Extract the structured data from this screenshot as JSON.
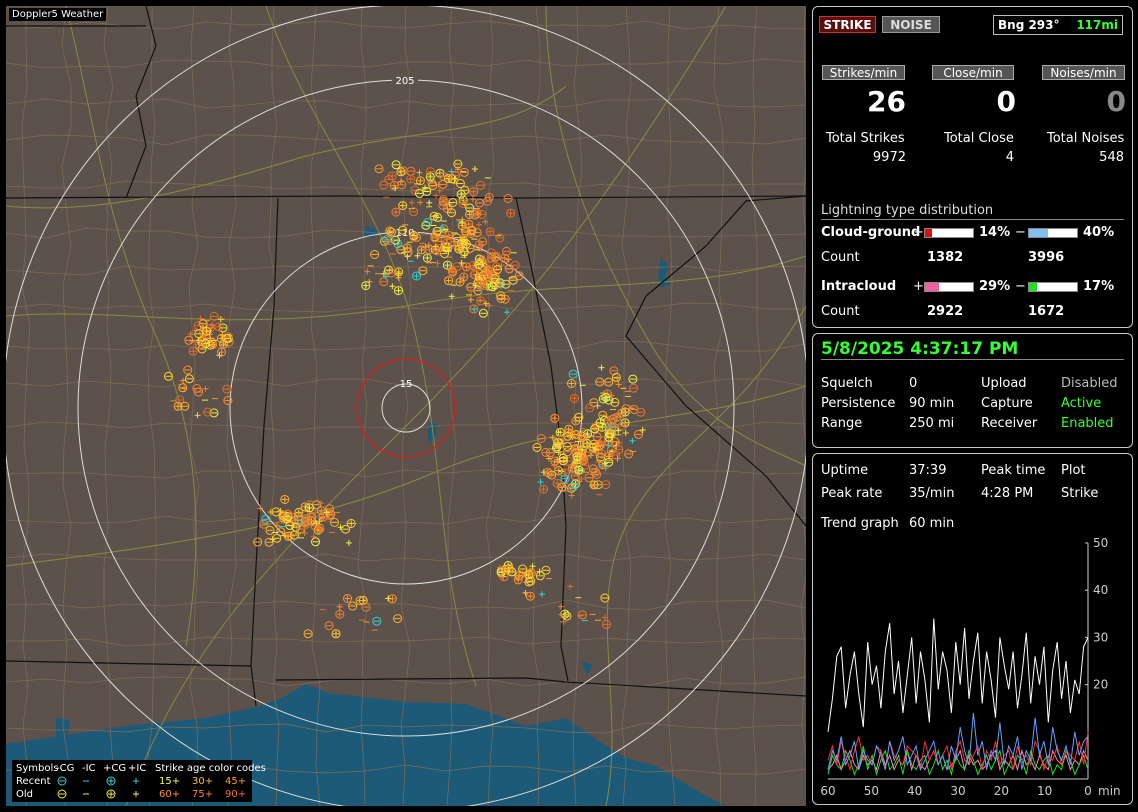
{
  "app": {
    "title": "Doppler5 Weather"
  },
  "map": {
    "ring_labels": [
      "205",
      "110",
      "15"
    ],
    "colors": {
      "land": "#5d514b",
      "water": "#1c5a78",
      "ring": "#dddddd",
      "inner_ring": "#d02020",
      "state_line": "#111111",
      "county_line": "#7d6e57",
      "road": "#8a8a3e"
    }
  },
  "legend": {
    "symbols_label": "Symbols",
    "types": [
      "-CG",
      "-IC",
      "+CG",
      "+IC"
    ],
    "age_label": "Strike age color codes",
    "recent_label": "Recent",
    "old_label": "Old",
    "recent_ages": [
      "15+",
      "30+",
      "45+"
    ],
    "old_ages": [
      "60+",
      "75+",
      "90+"
    ]
  },
  "status": {
    "strike_btn": "STRIKE",
    "noise_btn": "NOISE",
    "bearing": "Bng 293°",
    "distance": "117mi",
    "strikes_per_min_label": "Strikes/min",
    "close_per_min_label": "Close/min",
    "noises_per_min_label": "Noises/min",
    "strikes_per_min": "26",
    "close_per_min": "0",
    "noises_per_min": "0",
    "total_strikes_label": "Total Strikes",
    "total_close_label": "Total Close",
    "total_noises_label": "Total Noises",
    "total_strikes": "9972",
    "total_close": "4",
    "total_noises": "548",
    "dist_label": "Lightning type distribution",
    "cg_label": "Cloud-ground",
    "ic_label": "Intracloud",
    "count_label": "Count",
    "plus": "+",
    "minus": "−",
    "cg_pos_pct": "14%",
    "cg_neg_pct": "40%",
    "ic_pos_pct": "29%",
    "ic_neg_pct": "17%",
    "cg_pos_frac": 0.14,
    "cg_neg_frac": 0.4,
    "ic_pos_frac": 0.29,
    "ic_neg_frac": 0.17,
    "cg_pos_count": "1382",
    "cg_neg_count": "3996",
    "ic_pos_count": "2922",
    "ic_neg_count": "1672",
    "colors": {
      "cg_pos": "#e01010",
      "cg_neg": "#80c0f0",
      "ic_pos": "#f060a0",
      "ic_neg": "#20e020"
    }
  },
  "settings": {
    "datetime": "5/8/2025 4:37:17 PM",
    "squelch_label": "Squelch",
    "squelch": "0",
    "persistence_label": "Persistence",
    "persistence": "90 min",
    "range_label": "Range",
    "range": "250 mi",
    "upload_label": "Upload",
    "upload": "Disabled",
    "capture_label": "Capture",
    "capture": "Active",
    "receiver_label": "Receiver",
    "receiver": "Enabled"
  },
  "stats": {
    "uptime_label": "Uptime",
    "uptime": "37:39",
    "peak_time_label": "Peak time",
    "peak_time": "4:28 PM",
    "plot_label": "Plot",
    "plot_value": "Strike",
    "peak_rate_label": "Peak rate",
    "peak_rate": "35/min",
    "trend_label": "Trend graph",
    "trend_value": "60 min"
  },
  "chart_data": {
    "type": "line",
    "x_unit": "min",
    "xlim": [
      60,
      0
    ],
    "ylim": [
      0,
      50
    ],
    "x_ticks": [
      60,
      50,
      40,
      30,
      20,
      10,
      0
    ],
    "y_ticks": [
      50,
      40,
      30,
      20
    ],
    "series": [
      {
        "color": "#ffffff",
        "values": [
          10,
          17,
          26,
          28,
          15,
          22,
          27,
          18,
          11,
          29,
          20,
          24,
          15,
          27,
          33,
          18,
          25,
          14,
          22,
          30,
          16,
          27,
          21,
          12,
          34,
          19,
          27,
          23,
          14,
          29,
          20,
          32,
          17,
          25,
          31,
          16,
          27,
          21,
          13,
          30,
          24,
          19,
          27,
          15,
          22,
          31,
          16,
          26,
          20,
          28,
          12,
          23,
          29,
          17,
          25,
          14,
          21,
          18,
          28,
          30
        ]
      },
      {
        "color": "#60a0ff",
        "values": [
          2,
          6,
          4,
          9,
          3,
          5,
          8,
          2,
          6,
          4,
          3,
          7,
          5,
          2,
          8,
          4,
          6,
          9,
          3,
          5,
          7,
          2,
          4,
          6,
          8,
          3,
          5,
          2,
          7,
          4,
          11,
          6,
          3,
          14,
          5,
          8,
          2,
          6,
          4,
          12,
          3,
          7,
          5,
          9,
          2,
          6,
          4,
          13,
          5,
          8,
          3,
          11,
          6,
          4,
          7,
          3,
          10,
          5,
          8,
          9
        ]
      },
      {
        "color": "#ff3030",
        "values": [
          4,
          7,
          3,
          8,
          5,
          2,
          6,
          9,
          4,
          5,
          3,
          7,
          6,
          2,
          8,
          5,
          4,
          3,
          7,
          6,
          5,
          2,
          8,
          4,
          6,
          3,
          5,
          7,
          2,
          6,
          8,
          4,
          3,
          5,
          7,
          2,
          6,
          4,
          8,
          3,
          5,
          6,
          2,
          7,
          4,
          5,
          3,
          8,
          6,
          2,
          5,
          4,
          7,
          3,
          6,
          5,
          4,
          8,
          3,
          10
        ]
      },
      {
        "color": "#20e020",
        "values": [
          1,
          5,
          3,
          2,
          6,
          4,
          1,
          3,
          7,
          2,
          5,
          1,
          4,
          6,
          2,
          3,
          5,
          1,
          6,
          3,
          2,
          4,
          5,
          1,
          3,
          6,
          2,
          4,
          1,
          5,
          3,
          2,
          6,
          4,
          1,
          3,
          5,
          2,
          4,
          6,
          1,
          3,
          2,
          5,
          4,
          1,
          6,
          3,
          2,
          4,
          5,
          1,
          3,
          2,
          6,
          4,
          1,
          3,
          5,
          2
        ]
      },
      {
        "color": "#ff80c0",
        "values": [
          2,
          3,
          5,
          2,
          4,
          6,
          3,
          2,
          5,
          3,
          4,
          2,
          6,
          3,
          5,
          2,
          4,
          3,
          6,
          2,
          5,
          3,
          2,
          4,
          6,
          3,
          5,
          2,
          3,
          4,
          6,
          2,
          5,
          3,
          4,
          2,
          3,
          5,
          6,
          2,
          4,
          3,
          5,
          2,
          6,
          3,
          4,
          2,
          5,
          3,
          2,
          6,
          4,
          3,
          5,
          2,
          4,
          3,
          6,
          4
        ]
      }
    ]
  }
}
